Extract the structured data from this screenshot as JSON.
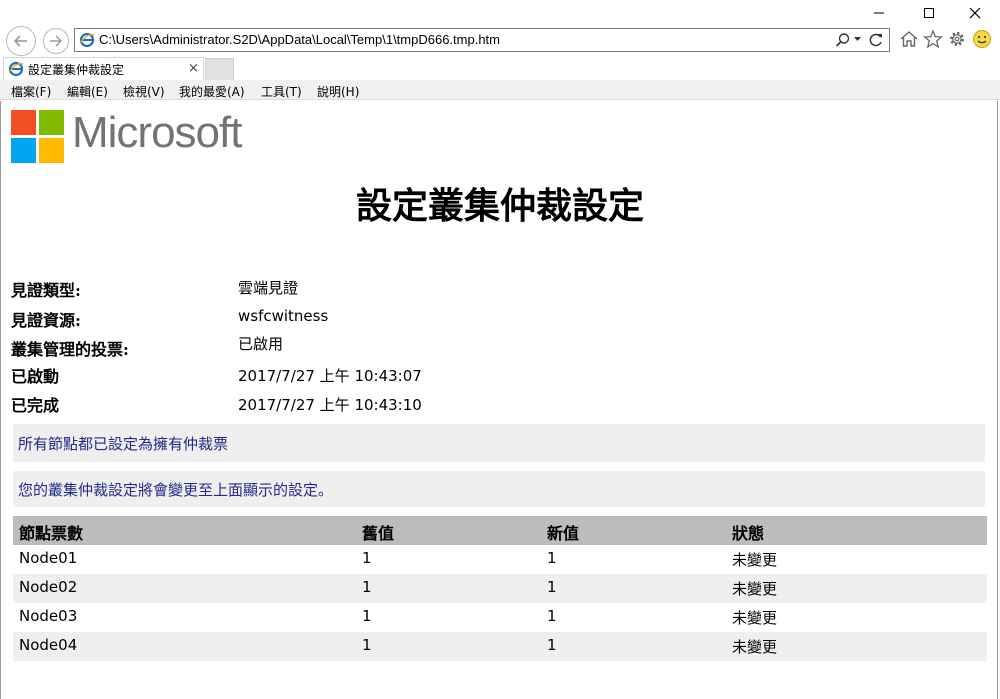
{
  "browser": {
    "address": "C:\\Users\\Administrator.S2D\\AppData\\Local\\Temp\\1\\tmpD666.tmp.htm",
    "tab_title": "設定叢集仲裁設定",
    "tab_close": "×",
    "menu": [
      "檔案(F)",
      "編輯(E)",
      "檢視(V)",
      "我的最愛(A)",
      "工具(T)",
      "說明(H)"
    ],
    "icons": {
      "back": "back-arrow-icon",
      "forward": "forward-arrow-icon",
      "search": "search-icon",
      "refresh": "refresh-icon",
      "home": "home-icon",
      "favorites": "star-icon",
      "settings": "gear-icon",
      "feedback": "smiley-icon"
    }
  },
  "logo": {
    "wordmark": "Microsoft",
    "colors": [
      "#f25022",
      "#7fba00",
      "#00a4ef",
      "#ffb900"
    ]
  },
  "report": {
    "title": "設定叢集仲裁設定",
    "properties": [
      {
        "label": "見證類型:",
        "value": "雲端見證"
      },
      {
        "label": "見證資源:",
        "value": "wsfcwitness"
      },
      {
        "label": "叢集管理的投票:",
        "value": "已啟用"
      },
      {
        "label": "已啟動",
        "value": "2017/7/27 上午 10:43:07"
      },
      {
        "label": "已完成",
        "value": "2017/7/27 上午 10:43:10"
      }
    ],
    "messages": [
      "所有節點都已設定為擁有仲裁票",
      "您的叢集仲裁設定將會變更至上面顯示的設定。"
    ],
    "table": {
      "headers": [
        "節點票數",
        "舊值",
        "新值",
        "狀態"
      ],
      "rows": [
        [
          "Node01",
          "1",
          "1",
          "未變更"
        ],
        [
          "Node02",
          "1",
          "1",
          "未變更"
        ],
        [
          "Node03",
          "1",
          "1",
          "未變更"
        ],
        [
          "Node04",
          "1",
          "1",
          "未變更"
        ]
      ]
    }
  },
  "colors": {
    "message_text": "#1f2a8a",
    "message_bg": "#efefef",
    "table_header_bg": "#bcbcbc"
  }
}
